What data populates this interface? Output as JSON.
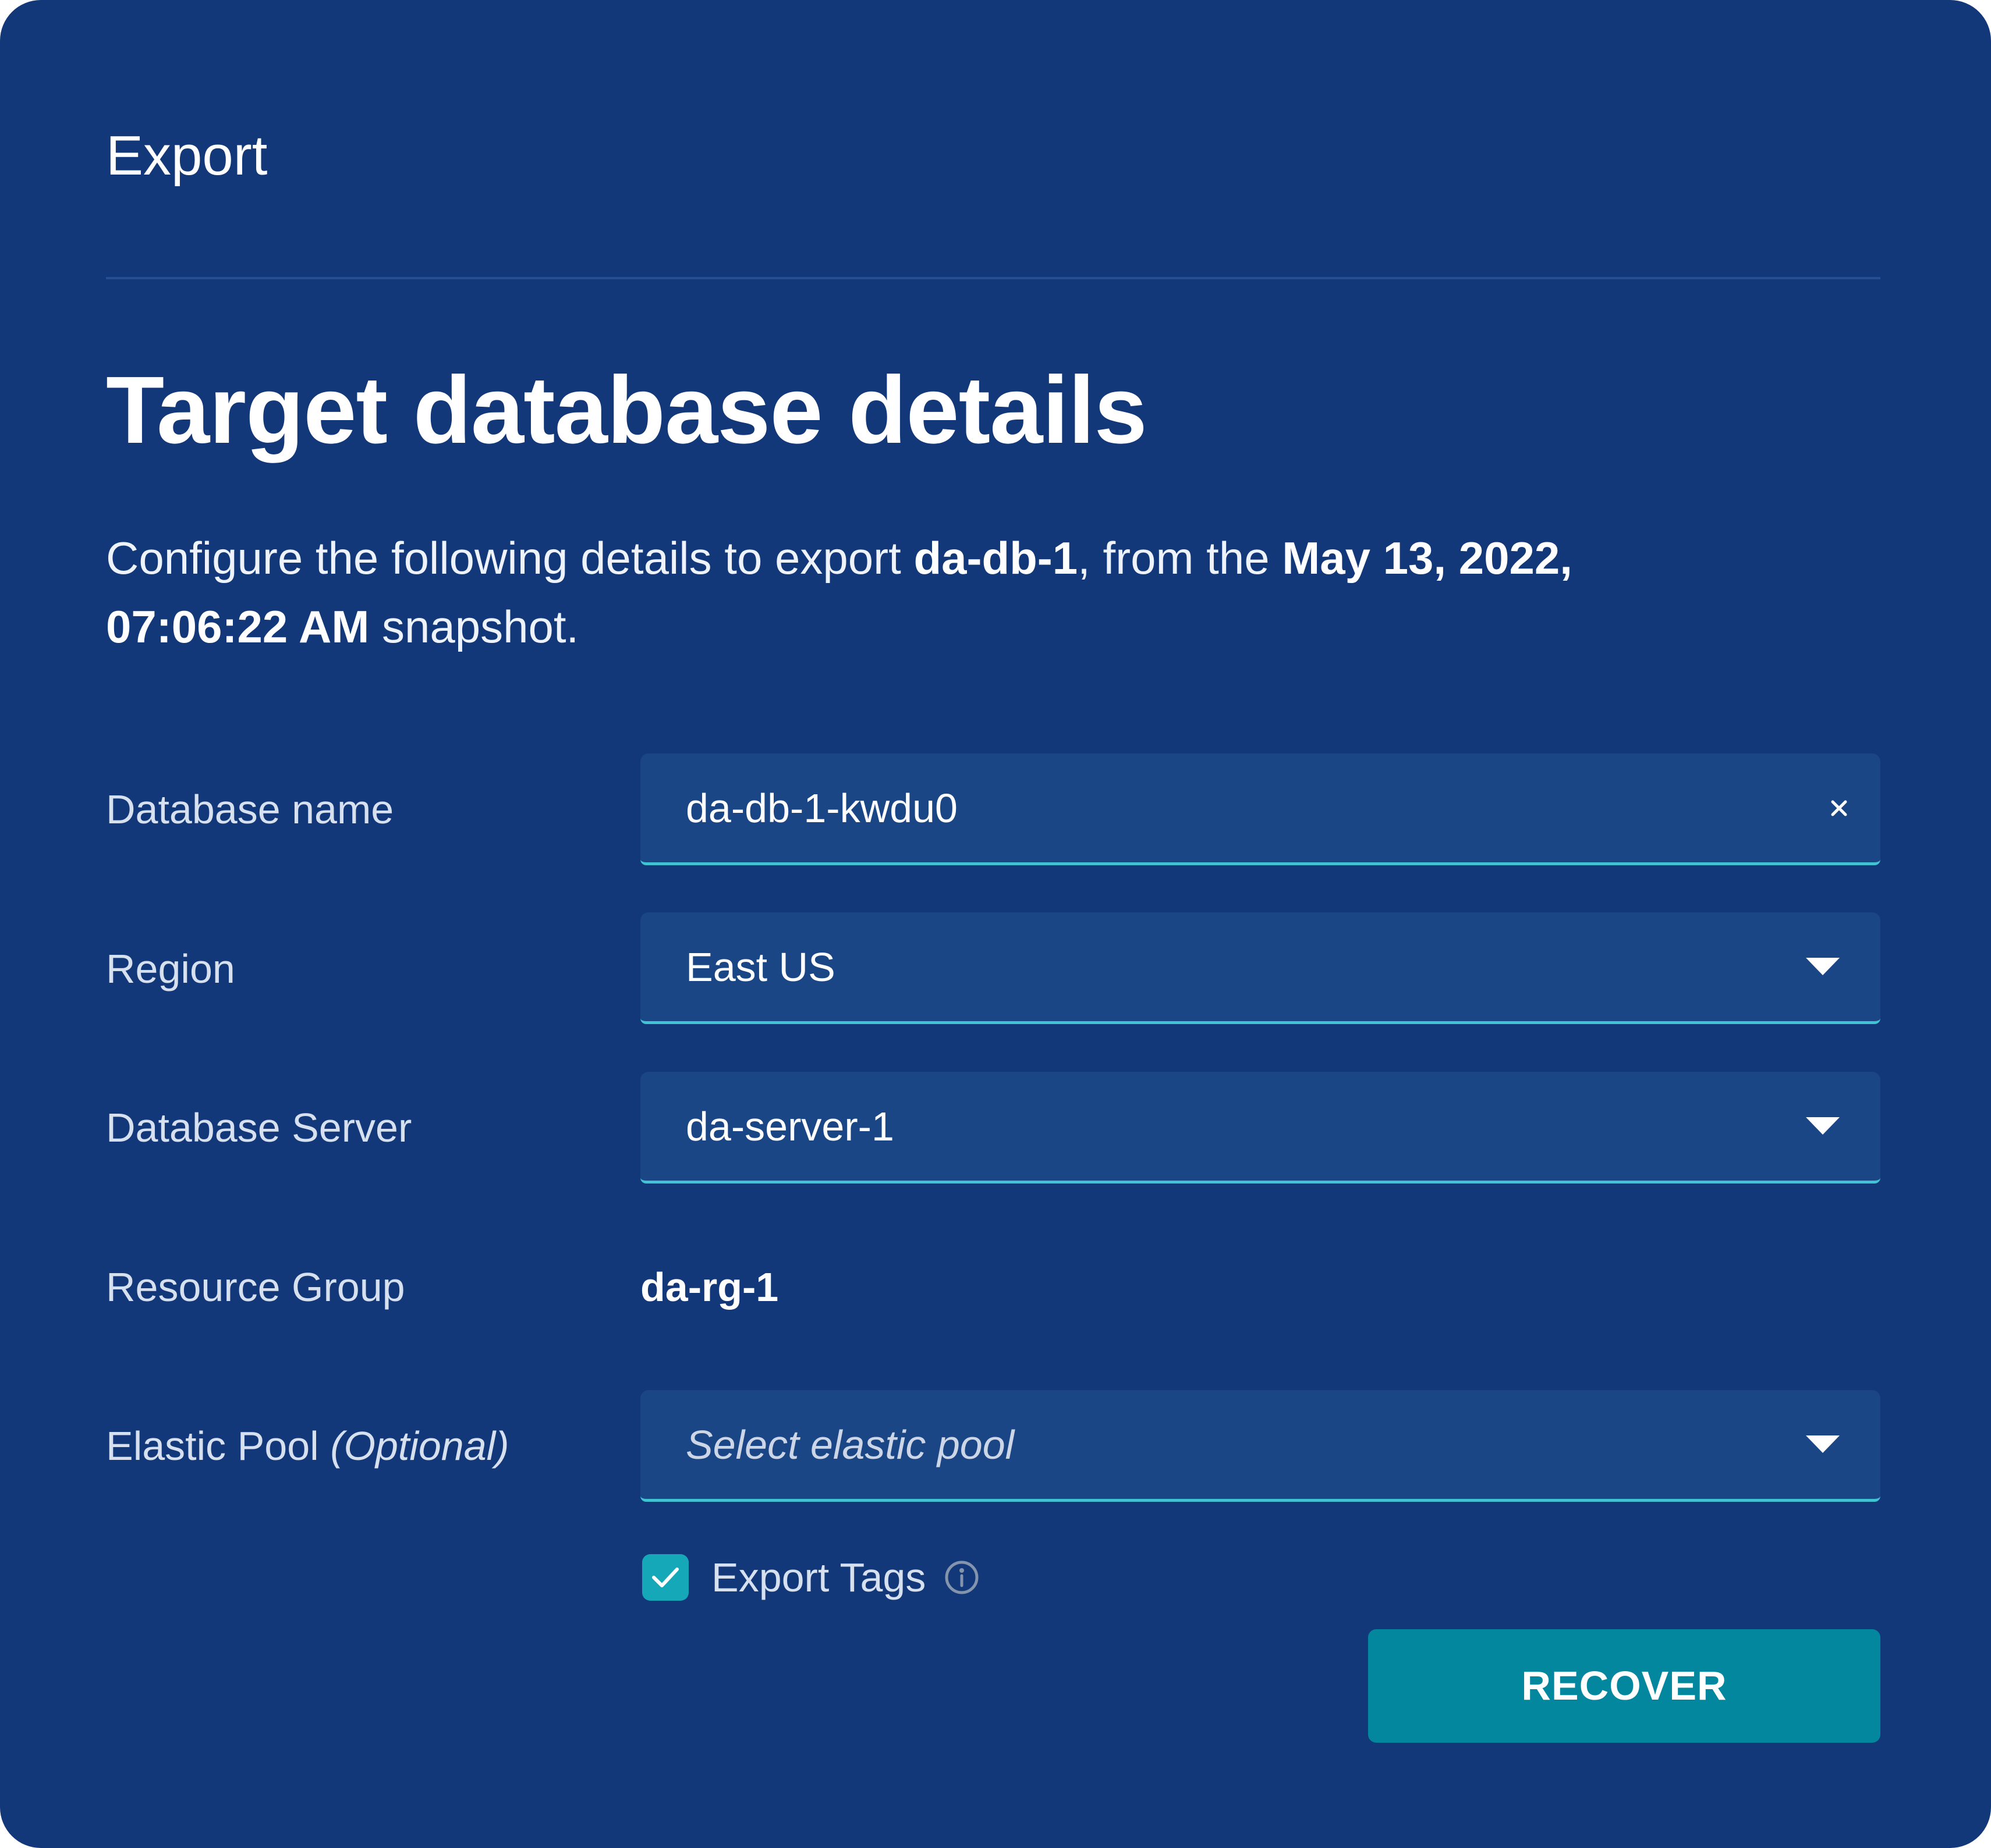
{
  "dialog": {
    "header_title": "Export",
    "page_title": "Target database details",
    "description": {
      "part1": "Configure the following details to export ",
      "db_name": "da-db-1",
      "part2": ", from the ",
      "snapshot_date": "May 13, 2022,",
      "snapshot_time": "07:06:22 AM",
      "part3": " snapshot."
    }
  },
  "form": {
    "database_name": {
      "label": "Database name",
      "value": "da-db-1-kwdu0",
      "clear_icon": "close-icon"
    },
    "region": {
      "label": "Region",
      "value": "East US",
      "icon": "chevron-down-icon"
    },
    "database_server": {
      "label": "Database Server",
      "value": "da-server-1",
      "icon": "chevron-down-icon"
    },
    "resource_group": {
      "label": "Resource Group",
      "value": "da-rg-1"
    },
    "elastic_pool": {
      "label": "Elastic Pool",
      "optional_label": "(Optional)",
      "placeholder": "Select elastic pool",
      "icon": "chevron-down-icon"
    },
    "export_tags": {
      "label": "Export Tags",
      "checked": true,
      "info_icon": "info-icon"
    }
  },
  "actions": {
    "recover_label": "RECOVER"
  },
  "colors": {
    "background": "#12387a",
    "field_background": "#1b4686",
    "accent_underline": "#40c4d3",
    "checkbox": "#14a8b8",
    "primary_button": "#03879f"
  }
}
